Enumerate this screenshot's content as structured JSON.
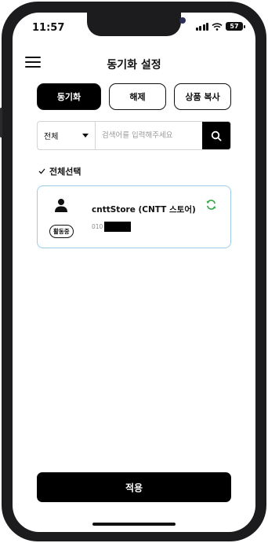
{
  "status_bar": {
    "time": "11:57",
    "battery": "57"
  },
  "header": {
    "title": "동기화 설정"
  },
  "segments": [
    {
      "label": "동기화",
      "active": true
    },
    {
      "label": "해제",
      "active": false
    },
    {
      "label": "상품 복사",
      "active": false
    }
  ],
  "search": {
    "select_value": "전체",
    "placeholder": "검색어를 입력해주세요"
  },
  "select_all": {
    "label": "전체선택"
  },
  "stores": [
    {
      "name": "cnttStore (CNTT 스토어)",
      "phone": "010",
      "status": "활동중"
    }
  ],
  "apply_button": {
    "label": "적용"
  },
  "colors": {
    "primary": "#000000",
    "card_border": "#9ccbe6",
    "sync_icon": "#3aa84a"
  }
}
